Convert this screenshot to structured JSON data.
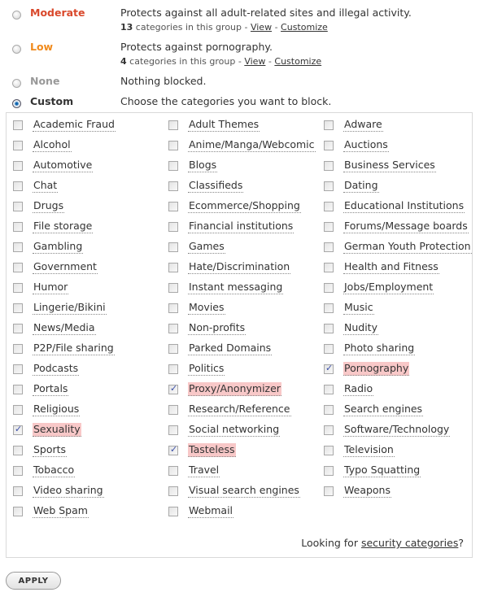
{
  "levels": [
    {
      "name": "Moderate",
      "color": "#d9482b",
      "desc": "Protects against all adult-related sites and illegal activity.",
      "count": "13",
      "count_suffix": " categories in this group - ",
      "view": "View",
      "customize": "Customize",
      "selected": false
    },
    {
      "name": "Low",
      "color": "#f08a1c",
      "desc": "Protects against pornography.",
      "count": "4",
      "count_suffix": " categories in this group - ",
      "view": "View",
      "customize": "Customize",
      "selected": false
    },
    {
      "name": "None",
      "color": "#999999",
      "desc": "Nothing blocked.",
      "selected": false
    },
    {
      "name": "Custom",
      "color": "#333333",
      "desc": "Choose the categories you want to block.",
      "selected": true
    }
  ],
  "separator": " - ",
  "categories": [
    [
      "Academic Fraud",
      "Adult Themes",
      "Adware"
    ],
    [
      "Alcohol",
      "Anime/Manga/Webcomic",
      "Auctions"
    ],
    [
      "Automotive",
      "Blogs",
      "Business Services"
    ],
    [
      "Chat",
      "Classifieds",
      "Dating"
    ],
    [
      "Drugs",
      "Ecommerce/Shopping",
      "Educational Institutions"
    ],
    [
      "File storage",
      "Financial institutions",
      "Forums/Message boards"
    ],
    [
      "Gambling",
      "Games",
      "German Youth Protection"
    ],
    [
      "Government",
      "Hate/Discrimination",
      "Health and Fitness"
    ],
    [
      "Humor",
      "Instant messaging",
      "Jobs/Employment"
    ],
    [
      "Lingerie/Bikini",
      "Movies",
      "Music"
    ],
    [
      "News/Media",
      "Non-profits",
      "Nudity"
    ],
    [
      "P2P/File sharing",
      "Parked Domains",
      "Photo sharing"
    ],
    [
      "Podcasts",
      "Politics",
      "Pornography"
    ],
    [
      "Portals",
      "Proxy/Anonymizer",
      "Radio"
    ],
    [
      "Religious",
      "Research/Reference",
      "Search engines"
    ],
    [
      "Sexuality",
      "Social networking",
      "Software/Technology"
    ],
    [
      "Sports",
      "Tasteless",
      "Television"
    ],
    [
      "Tobacco",
      "Travel",
      "Typo Squatting"
    ],
    [
      "Video sharing",
      "Visual search engines",
      "Weapons"
    ],
    [
      "Web Spam",
      "Webmail",
      null
    ]
  ],
  "checked": [
    "Pornography",
    "Proxy/Anonymizer",
    "Sexuality",
    "Tasteless"
  ],
  "security": {
    "prefix": "Looking for ",
    "link": "security categories",
    "suffix": "?"
  },
  "apply_label": "APPLY"
}
